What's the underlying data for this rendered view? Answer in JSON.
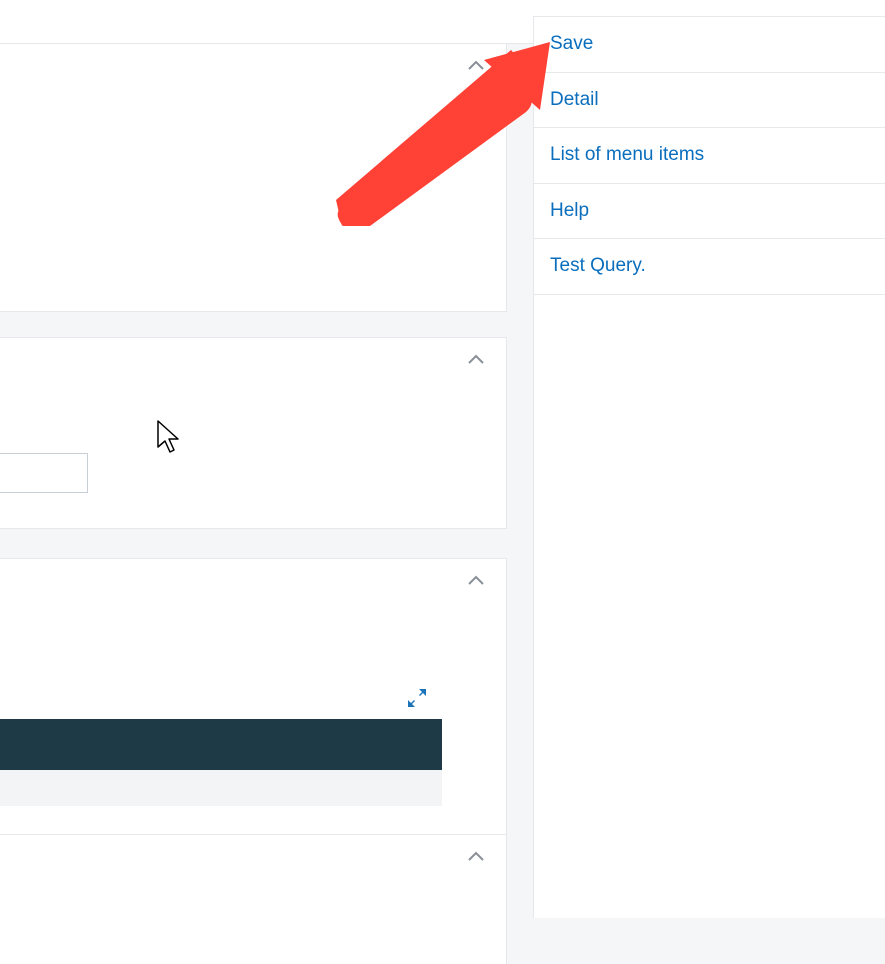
{
  "menu": {
    "save": "Save",
    "detail": "Detail",
    "list": "List of menu items",
    "help": "Help",
    "test_query": "Test Query."
  },
  "left": {
    "field_value": ""
  }
}
